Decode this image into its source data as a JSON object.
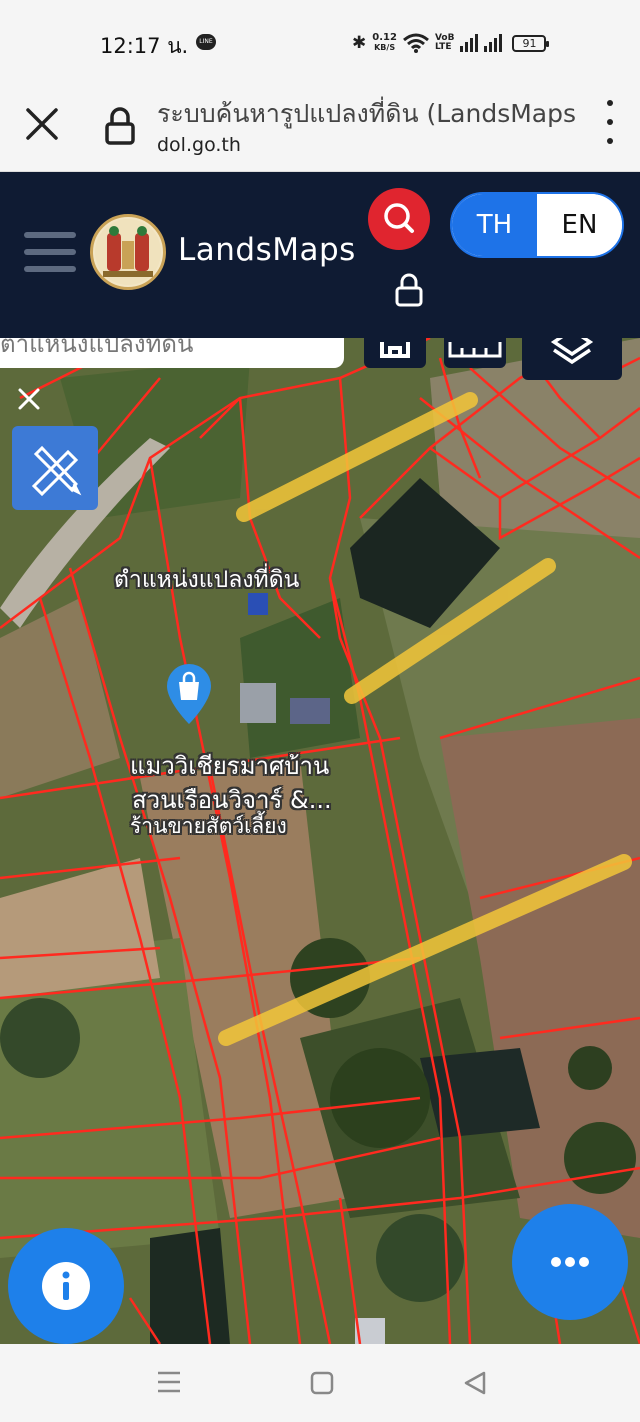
{
  "status_bar": {
    "time": "12:17 น.",
    "line_badge": "LINE",
    "net_speed_value": "0.12",
    "net_speed_unit": "KB/S",
    "volte_top": "VoB",
    "volte_bottom": "LTE",
    "battery": "91"
  },
  "browser": {
    "page_title": "ระบบค้นหารูปแปลงที่ดิน (LandsMaps)",
    "domain": "dol.go.th"
  },
  "app_header": {
    "brand": "LandsMaps",
    "lang_th": "TH",
    "lang_en": "EN",
    "active_lang": "TH",
    "accent_color": "#1e73e8",
    "search_color": "#e0252f",
    "header_bg": "#0f1b33"
  },
  "map": {
    "search_text": "ตำแหน่งแปลงที่ดิน",
    "parcel_label": "ตำแหน่งแปลงที่ดิน",
    "place_line1": "แมววิเชียรมาศบ้าน",
    "place_line2": "สวนเรือนวิจาร์ &...",
    "place_line3": "ร้านขายสัตว์เลี้ยง",
    "boundary_color": "#ff2a1f",
    "highlight_color": "#f2c53a"
  },
  "icons": {
    "close_tab": "close-icon",
    "url_lock": "lock-icon",
    "menu": "hamburger-icon",
    "search": "search-icon",
    "layers": "layers-icon",
    "measure": "ruler-pencil-icon",
    "info": "info-icon",
    "more": "more-icon"
  }
}
